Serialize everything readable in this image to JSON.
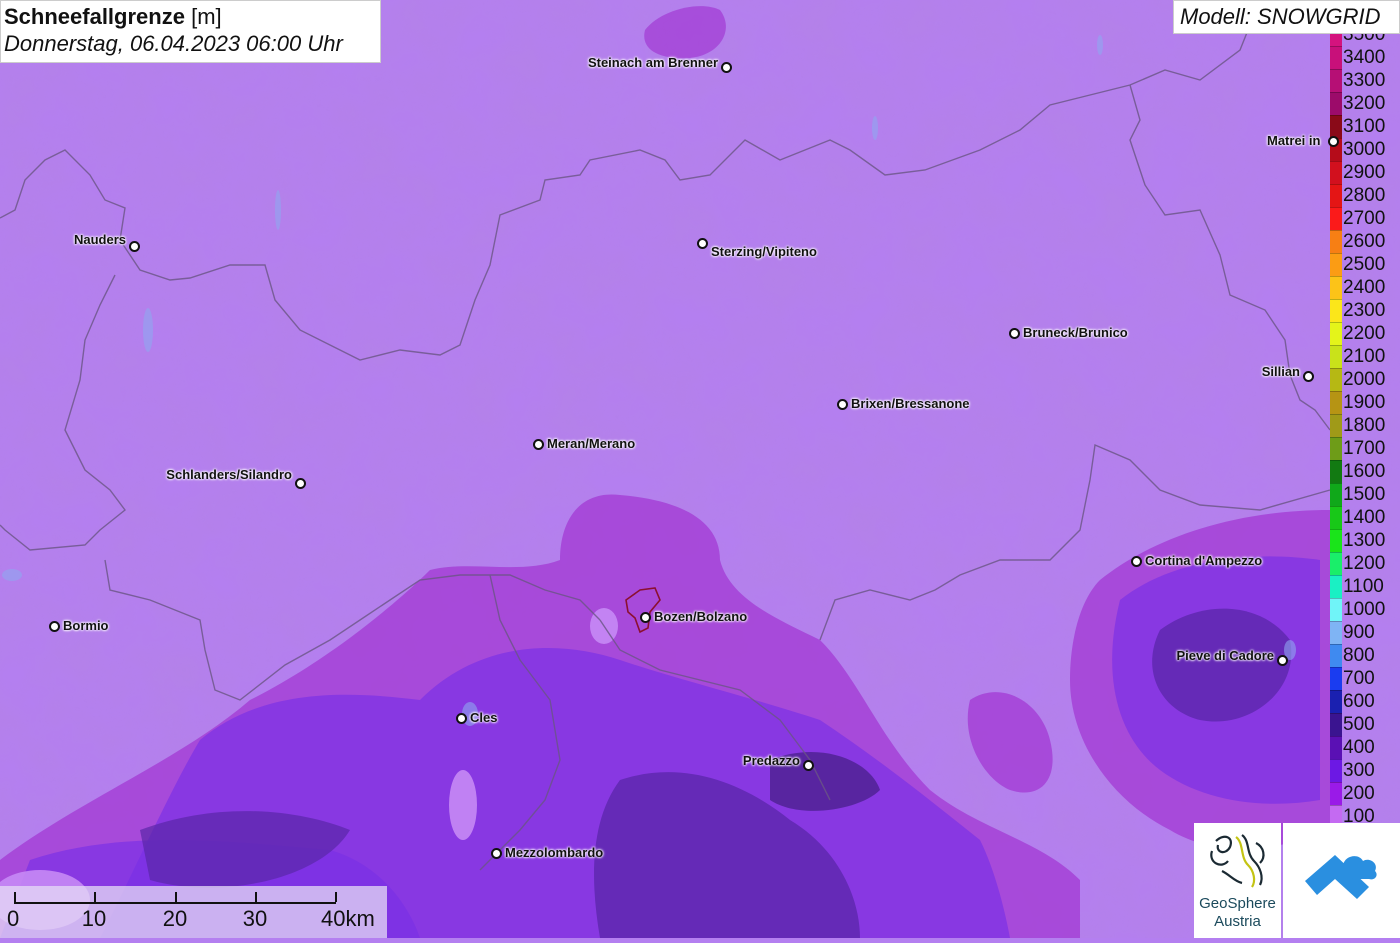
{
  "header": {
    "title_bold": "Schneefallgrenze",
    "title_unit": "[m]",
    "subtitle": "Donnerstag, 06.04.2023 06:00 Uhr",
    "model": "Modell: SNOWGRID"
  },
  "legend": [
    {
      "label": "3500",
      "color": "#d4137e"
    },
    {
      "label": "3400",
      "color": "#c8107a"
    },
    {
      "label": "3300",
      "color": "#b60f75"
    },
    {
      "label": "3200",
      "color": "#9c0b6a"
    },
    {
      "label": "3100",
      "color": "#8a0a18"
    },
    {
      "label": "3000",
      "color": "#b50c1a"
    },
    {
      "label": "2900",
      "color": "#d2101e"
    },
    {
      "label": "2800",
      "color": "#e41515"
    },
    {
      "label": "2700",
      "color": "#fb1a1a"
    },
    {
      "label": "2600",
      "color": "#f77f14"
    },
    {
      "label": "2500",
      "color": "#fb9c14"
    },
    {
      "label": "2400",
      "color": "#fcc318"
    },
    {
      "label": "2300",
      "color": "#fbe61a"
    },
    {
      "label": "2200",
      "color": "#e4f41a"
    },
    {
      "label": "2100",
      "color": "#c9e21a"
    },
    {
      "label": "2000",
      "color": "#b6b814"
    },
    {
      "label": "1900",
      "color": "#b69414"
    },
    {
      "label": "1800",
      "color": "#a09a18"
    },
    {
      "label": "1700",
      "color": "#6e9c18"
    },
    {
      "label": "1600",
      "color": "#127a12"
    },
    {
      "label": "1500",
      "color": "#10a81a"
    },
    {
      "label": "1400",
      "color": "#18c818"
    },
    {
      "label": "1300",
      "color": "#1ae41a"
    },
    {
      "label": "1200",
      "color": "#1aee6a"
    },
    {
      "label": "1100",
      "color": "#1af0c4"
    },
    {
      "label": "1000",
      "color": "#70f4f8"
    },
    {
      "label": "900",
      "color": "#7fb4f4"
    },
    {
      "label": "800",
      "color": "#3f8af0"
    },
    {
      "label": "700",
      "color": "#1a3cf0"
    },
    {
      "label": "600",
      "color": "#1a20b0"
    },
    {
      "label": "500",
      "color": "#3a1490"
    },
    {
      "label": "400",
      "color": "#5a10b4"
    },
    {
      "label": "300",
      "color": "#6c18e4"
    },
    {
      "label": "200",
      "color": "#9a1ae8"
    },
    {
      "label": "100",
      "color": "#c46af2"
    }
  ],
  "cities": [
    {
      "name": "Steinach am Brenner",
      "side": "left"
    },
    {
      "name": "Matrei in",
      "side": "left"
    },
    {
      "name": "Nauders",
      "side": "left"
    },
    {
      "name": "Sterzing/Vipiteno",
      "side": "right"
    },
    {
      "name": "Bruneck/Brunico",
      "side": "right"
    },
    {
      "name": "Sillian",
      "side": "left"
    },
    {
      "name": "Brixen/Bressanone",
      "side": "right"
    },
    {
      "name": "Meran/Merano",
      "side": "right"
    },
    {
      "name": "Schlanders/Silandro",
      "side": "left"
    },
    {
      "name": "Cortina d'Ampezzo",
      "side": "right"
    },
    {
      "name": "Bormio",
      "side": "right"
    },
    {
      "name": "Bozen/Bolzano",
      "side": "right"
    },
    {
      "name": "Pieve di Cadore",
      "side": "left"
    },
    {
      "name": "Cles",
      "side": "right"
    },
    {
      "name": "Predazzo",
      "side": "left"
    },
    {
      "name": "Mezzolombardo",
      "side": "right"
    }
  ],
  "scale": {
    "labels": [
      "0",
      "10",
      "20",
      "30",
      "40km"
    ]
  },
  "logos": {
    "geosphere_line1": "GeoSphere",
    "geosphere_line2": "Austria"
  }
}
